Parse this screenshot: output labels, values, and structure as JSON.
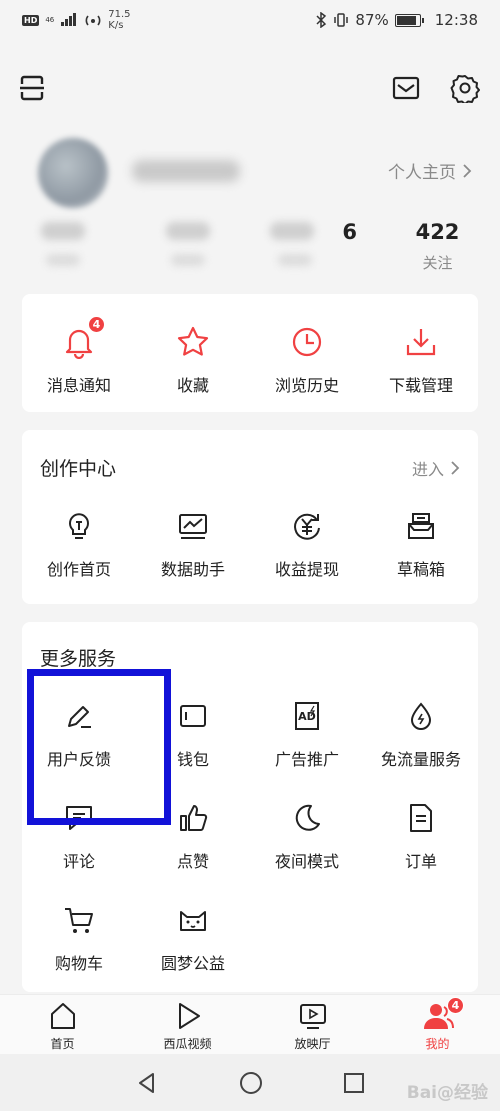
{
  "status_bar": {
    "network_badge": "HD",
    "signal_small": "46",
    "speed_value": "71.5",
    "speed_unit": "K/s",
    "battery_percent": "87%",
    "time": "12:38"
  },
  "top_bar": {
    "left_icon": "scan-icon",
    "right_icons": [
      "mail-icon",
      "settings-gear-icon"
    ]
  },
  "profile": {
    "home_link": "个人主页",
    "stats": [
      {
        "num": "6",
        "label": ""
      },
      {
        "num": "422",
        "label": "关注"
      }
    ]
  },
  "quick_actions": [
    {
      "label": "消息通知",
      "icon": "bell-icon",
      "badge": "4"
    },
    {
      "label": "收藏",
      "icon": "star-icon"
    },
    {
      "label": "浏览历史",
      "icon": "clock-icon"
    },
    {
      "label": "下载管理",
      "icon": "download-icon"
    }
  ],
  "creation_center": {
    "title": "创作中心",
    "link": "进入",
    "items": [
      {
        "label": "创作首页",
        "icon": "bulb-icon"
      },
      {
        "label": "数据助手",
        "icon": "chart-monitor-icon"
      },
      {
        "label": "收益提现",
        "icon": "yuan-icon"
      },
      {
        "label": "草稿箱",
        "icon": "draft-box-icon"
      }
    ]
  },
  "more_services": {
    "title": "更多服务",
    "items": [
      {
        "label": "用户反馈",
        "icon": "pen-icon"
      },
      {
        "label": "钱包",
        "icon": "wallet-icon"
      },
      {
        "label": "广告推广",
        "icon": "ad-icon"
      },
      {
        "label": "免流量服务",
        "icon": "drop-icon"
      },
      {
        "label": "评论",
        "icon": "comment-icon"
      },
      {
        "label": "点赞",
        "icon": "thumb-up-icon"
      },
      {
        "label": "夜间模式",
        "icon": "moon-icon"
      },
      {
        "label": "订单",
        "icon": "order-icon"
      },
      {
        "label": "购物车",
        "icon": "cart-icon"
      },
      {
        "label": "圆梦公益",
        "icon": "cat-icon"
      }
    ]
  },
  "tab_bar": [
    {
      "label": "首页",
      "icon": "home-icon"
    },
    {
      "label": "西瓜视频",
      "icon": "play-icon"
    },
    {
      "label": "放映厅",
      "icon": "tv-icon"
    },
    {
      "label": "我的",
      "icon": "user-icon",
      "badge": "4",
      "active": true
    }
  ],
  "watermark": "Bai@经验",
  "colors": {
    "accent": "#f04142",
    "highlight": "#1212d8"
  }
}
